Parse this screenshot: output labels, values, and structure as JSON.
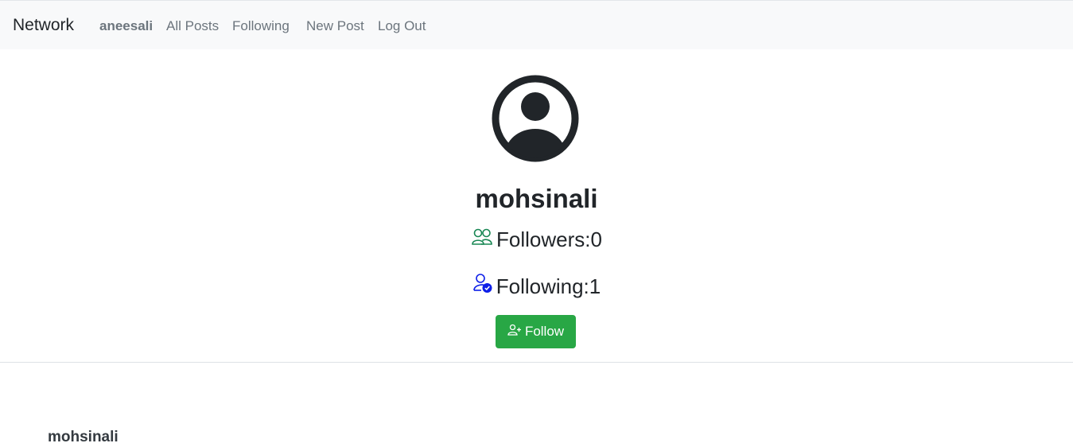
{
  "navbar": {
    "brand": "Network",
    "links": {
      "user": "aneesali",
      "all_posts": "All Posts",
      "following": "Following",
      "new_post": "New Post",
      "log_out": "Log Out"
    },
    "background": "#f8f9fa"
  },
  "profile": {
    "avatar_icon": "person-circle-icon",
    "username": "mohsinali",
    "followers": {
      "icon": "people-icon",
      "icon_color": "#198754",
      "text": "Followers:0"
    },
    "following": {
      "icon": "person-check-icon",
      "icon_color": "#0d1ee8",
      "text": "Following:1"
    },
    "follow_button": {
      "icon": "person-plus-icon",
      "label": "Follow",
      "color": "#28a745"
    }
  },
  "posts": [
    {
      "author": "mohsinali"
    }
  ]
}
